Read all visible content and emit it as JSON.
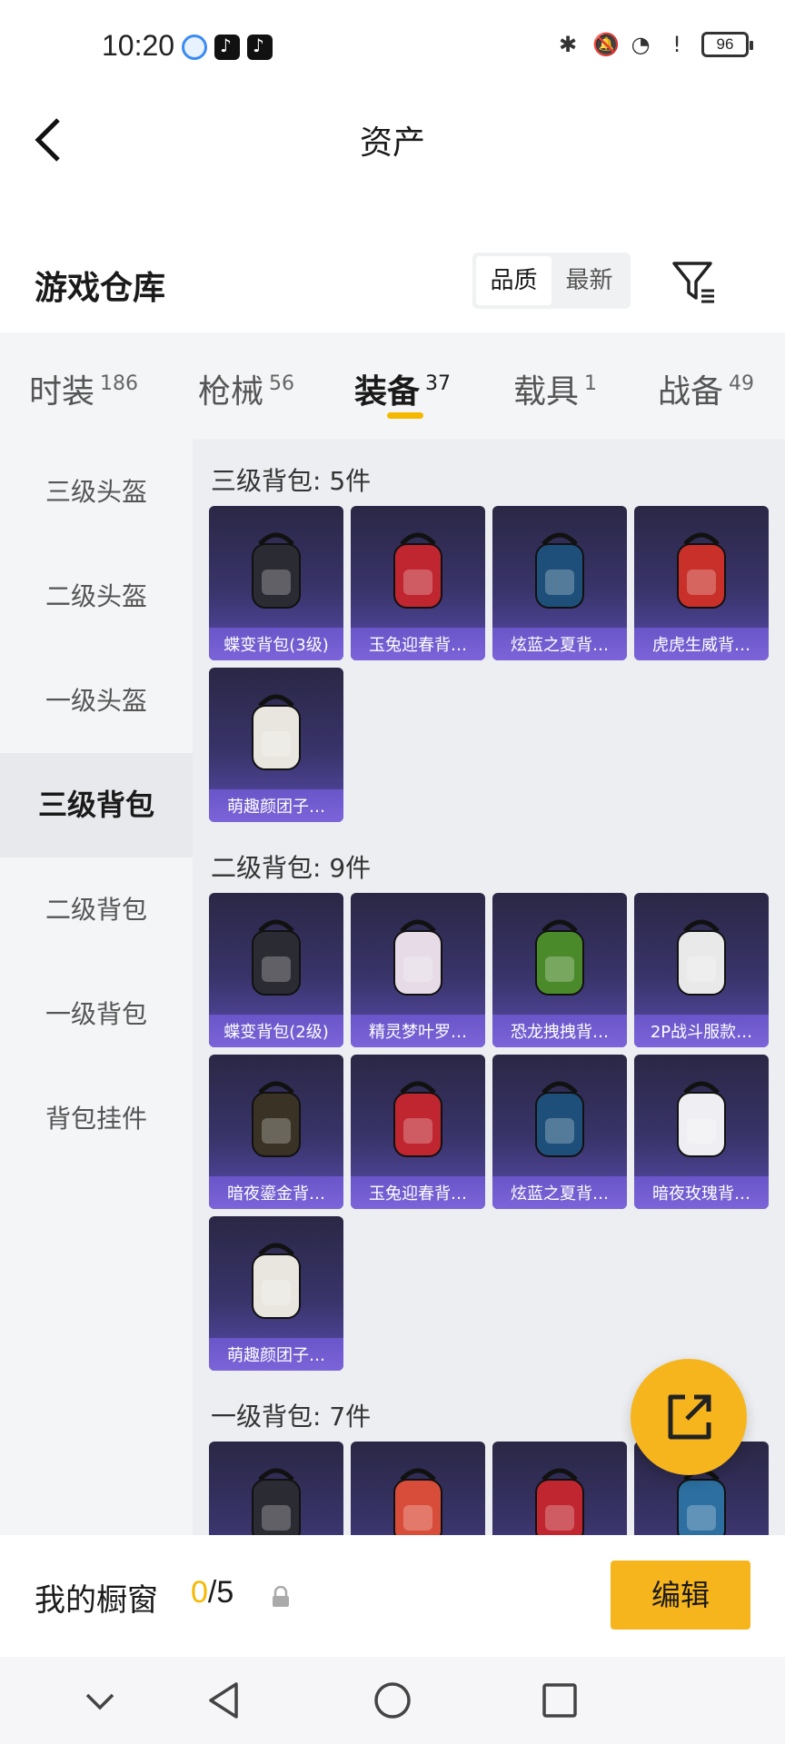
{
  "status_bar": {
    "time": "10:20",
    "battery": "96"
  },
  "header": {
    "title": "资产"
  },
  "warehouse": {
    "title": "游戏仓库",
    "sort_options": [
      "品质",
      "最新"
    ]
  },
  "tabs": [
    {
      "label": "时装",
      "count": "186"
    },
    {
      "label": "枪械",
      "count": "56"
    },
    {
      "label": "装备",
      "count": "37"
    },
    {
      "label": "载具",
      "count": "1"
    },
    {
      "label": "战备",
      "count": "49"
    }
  ],
  "categories": [
    "三级头盔",
    "二级头盔",
    "一级头盔",
    "三级背包",
    "二级背包",
    "一级背包",
    "背包挂件"
  ],
  "sections": [
    {
      "title": "三级背包: 5件",
      "items": [
        "蝶变背包(3级)",
        "玉兔迎春背…",
        "炫蓝之夏背…",
        "虎虎生威背…",
        "萌趣颜团子…"
      ]
    },
    {
      "title": "二级背包: 9件",
      "items": [
        "蝶变背包(2级)",
        "精灵梦叶罗…",
        "恐龙拽拽背…",
        "2P战斗服款…",
        "暗夜鎏金背…",
        "玉兔迎春背…",
        "炫蓝之夏背…",
        "暗夜玫瑰背…",
        "萌趣颜团子…"
      ]
    },
    {
      "title": "一级背包: 7件",
      "items": [
        "",
        "",
        "",
        ""
      ]
    }
  ],
  "showcase": {
    "label": "我的橱窗",
    "current": "0",
    "total": "/5"
  },
  "edit_button": "编辑"
}
